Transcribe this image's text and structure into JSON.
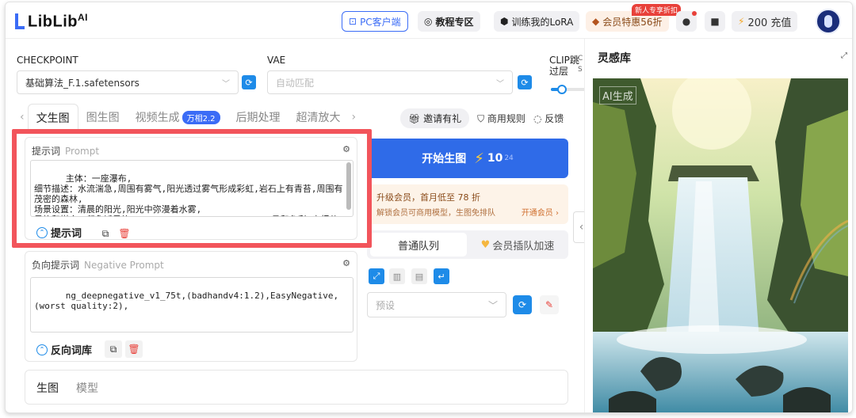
{
  "header": {
    "logo_text": "LibLib",
    "logo_ai": "AI",
    "pc_client": "PC客户端",
    "course_zone": "教程专区",
    "train_lora": "训练我的LoRA",
    "vip_label": "会员特惠56折",
    "vip_tag": "新人专享折扣",
    "recharge": "200 充值"
  },
  "settings": {
    "checkpoint_label": "CHECKPOINT",
    "checkpoint_value": "基础算法_F.1.safetensors",
    "vae_label": "VAE",
    "vae_placeholder": "自动匹配",
    "clip_label": "CLIP跳过层",
    "clip_cut_a": "C",
    "clip_cut_b": "S"
  },
  "tabs": [
    {
      "label": "文生图",
      "active": true
    },
    {
      "label": "图生图"
    },
    {
      "label": "视频生成",
      "badge": "万相2.2"
    },
    {
      "label": "后期处理"
    },
    {
      "label": "超清放大"
    }
  ],
  "top_links": {
    "invite": "邀请有礼",
    "commercial_rules": "商用规则",
    "feedback": "反馈"
  },
  "prompt": {
    "title": "提示词",
    "title_en": "Prompt",
    "text": "主体：一座瀑布,\n细节描述：水流湍急,周围有雾气,阳光透过雾气形成彩虹,岩石上有青苔,周围有茂密的森林,\n场景设置：清晨的阳光,阳光中弥漫着水雾,\n风格和媒介：印象派风格,(((ink))), ((watercolor)),柔和色彩,高细节,",
    "words_btn": "提示词"
  },
  "negative": {
    "title": "负向提示词",
    "title_en": "Negative Prompt",
    "text": "ng_deepnegative_v1_75t,(badhandv4:1.2),EasyNegative,(worst quality:2),",
    "words_btn": "反向词库"
  },
  "bottom_tabs": {
    "gen": "生图",
    "model": "模型"
  },
  "generate": {
    "label": "开始生图",
    "cost": "10",
    "cost_sub": "24"
  },
  "promo": {
    "title": "升级会员，首月低至 78 折",
    "subtitle": "解锁会员可商用模型，生图免排队",
    "link": "开通会员 ›"
  },
  "queue": {
    "normal": "普通队列",
    "vip": "会员插队加速"
  },
  "preset": {
    "placeholder": "预设"
  },
  "inspiration": {
    "title": "灵感库",
    "image_tag": "AI生成"
  },
  "colors": {
    "accent": "#2f6be8",
    "highlight": "#f2545b"
  }
}
